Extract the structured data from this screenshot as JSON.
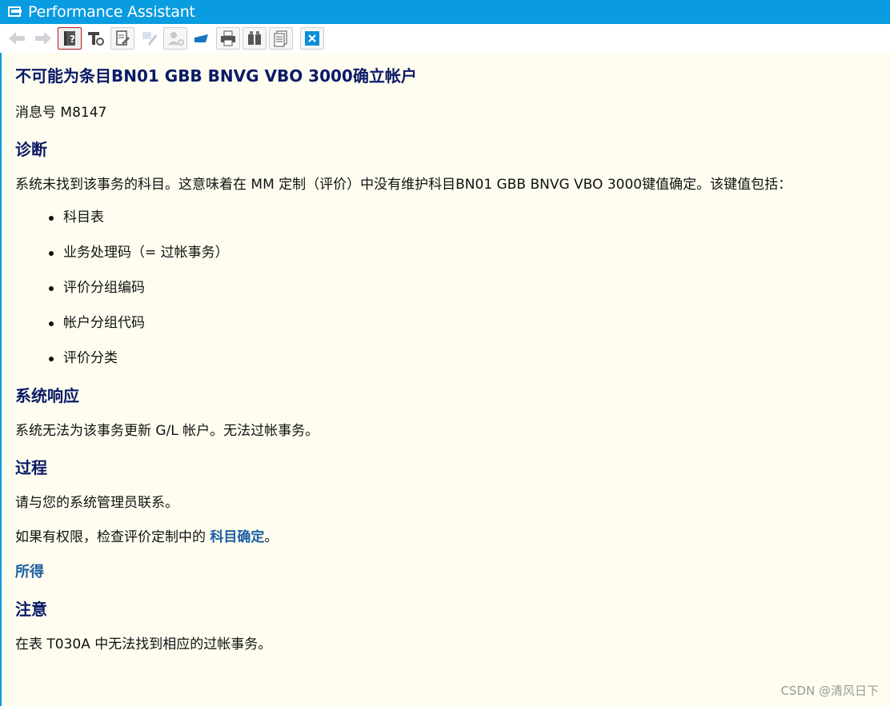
{
  "window": {
    "title": "Performance Assistant"
  },
  "toolbar": {
    "buttons": [
      {
        "icon": "back-arrow-icon"
      },
      {
        "icon": "forward-arrow-icon"
      },
      {
        "icon": "help-book-icon"
      },
      {
        "icon": "technical-info-icon"
      },
      {
        "icon": "edit-document-icon"
      },
      {
        "icon": "annotate-icon"
      },
      {
        "icon": "user-settings-icon"
      },
      {
        "icon": "tag-icon"
      },
      {
        "icon": "print-icon"
      },
      {
        "icon": "find-icon"
      },
      {
        "icon": "document-list-icon"
      },
      {
        "icon": "close-icon"
      }
    ],
    "colors": {
      "accent": "#0a9ce0",
      "active_border": "#b21b1b"
    }
  },
  "doc": {
    "title": "不可能为条目BN01 GBB BNVG VBO 3000确立帐户",
    "message_no": "消息号 M8147",
    "diagnosis_heading": "诊断",
    "diagnosis_text": "系统未找到该事务的科目。这意味着在 MM 定制（评价）中没有维护科目BN01 GBB BNVG VBO 3000键值确定。该键值包括：",
    "diagnosis_items": [
      "科目表",
      "业务处理码（= 过帐事务）",
      "评价分组编码",
      "帐户分组代码",
      "评价分类"
    ],
    "response_heading": "系统响应",
    "response_text": "系统无法为该事务更新 G/L 帐户。无法过帐事务。",
    "procedure_heading": "过程",
    "procedure_text1": "请与您的系统管理员联系。",
    "procedure_text2_prefix": "如果有权限，检查评价定制中的 ",
    "procedure_link": "科目确定",
    "procedure_text2_suffix": "。",
    "result_link": "所得",
    "note_heading": "注意",
    "note_text": "在表 T030A 中无法找到相应的过帐事务。"
  },
  "watermark": "CSDN @清风日下",
  "colors": {
    "heading": "#0b1a66",
    "link": "#1d5fa3",
    "background": "#fefdf0"
  }
}
